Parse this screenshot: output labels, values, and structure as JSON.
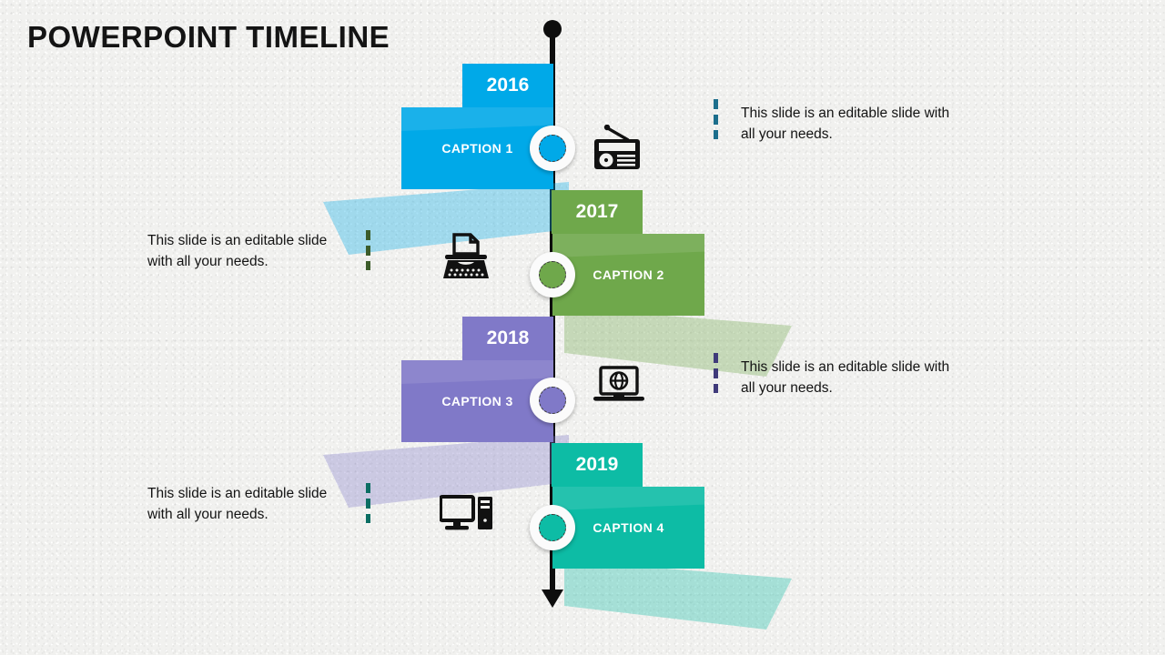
{
  "slide": {
    "title": "POWERPOINT TIMELINE",
    "background_color": "#f1f1ef",
    "axis_color": "#0d0d0d"
  },
  "entries": [
    {
      "year": "2016",
      "caption": "CAPTION 1",
      "description": "This slide is an editable slide with all your needs.",
      "color": "#00a9e8",
      "accent_color": "#1c6e8c",
      "icon": "radio-icon",
      "side": "left",
      "text_side": "right"
    },
    {
      "year": "2017",
      "caption": "CAPTION 2",
      "description": "This slide is an editable slide with all your needs.",
      "color": "#6fa84b",
      "accent_color": "#3c5c2a",
      "icon": "typewriter-icon",
      "side": "right",
      "text_side": "left"
    },
    {
      "year": "2018",
      "caption": "CAPTION 3",
      "description": "This slide is an editable slide with all your needs.",
      "color": "#8079c8",
      "accent_color": "#3f3a7a",
      "icon": "laptop-globe-icon",
      "side": "left",
      "text_side": "right"
    },
    {
      "year": "2019",
      "caption": "CAPTION 4",
      "description": "This slide is an editable slide with all your needs.",
      "color": "#0dbca5",
      "accent_color": "#0b6e63",
      "icon": "desktop-computer-icon",
      "side": "right",
      "text_side": "left"
    }
  ]
}
